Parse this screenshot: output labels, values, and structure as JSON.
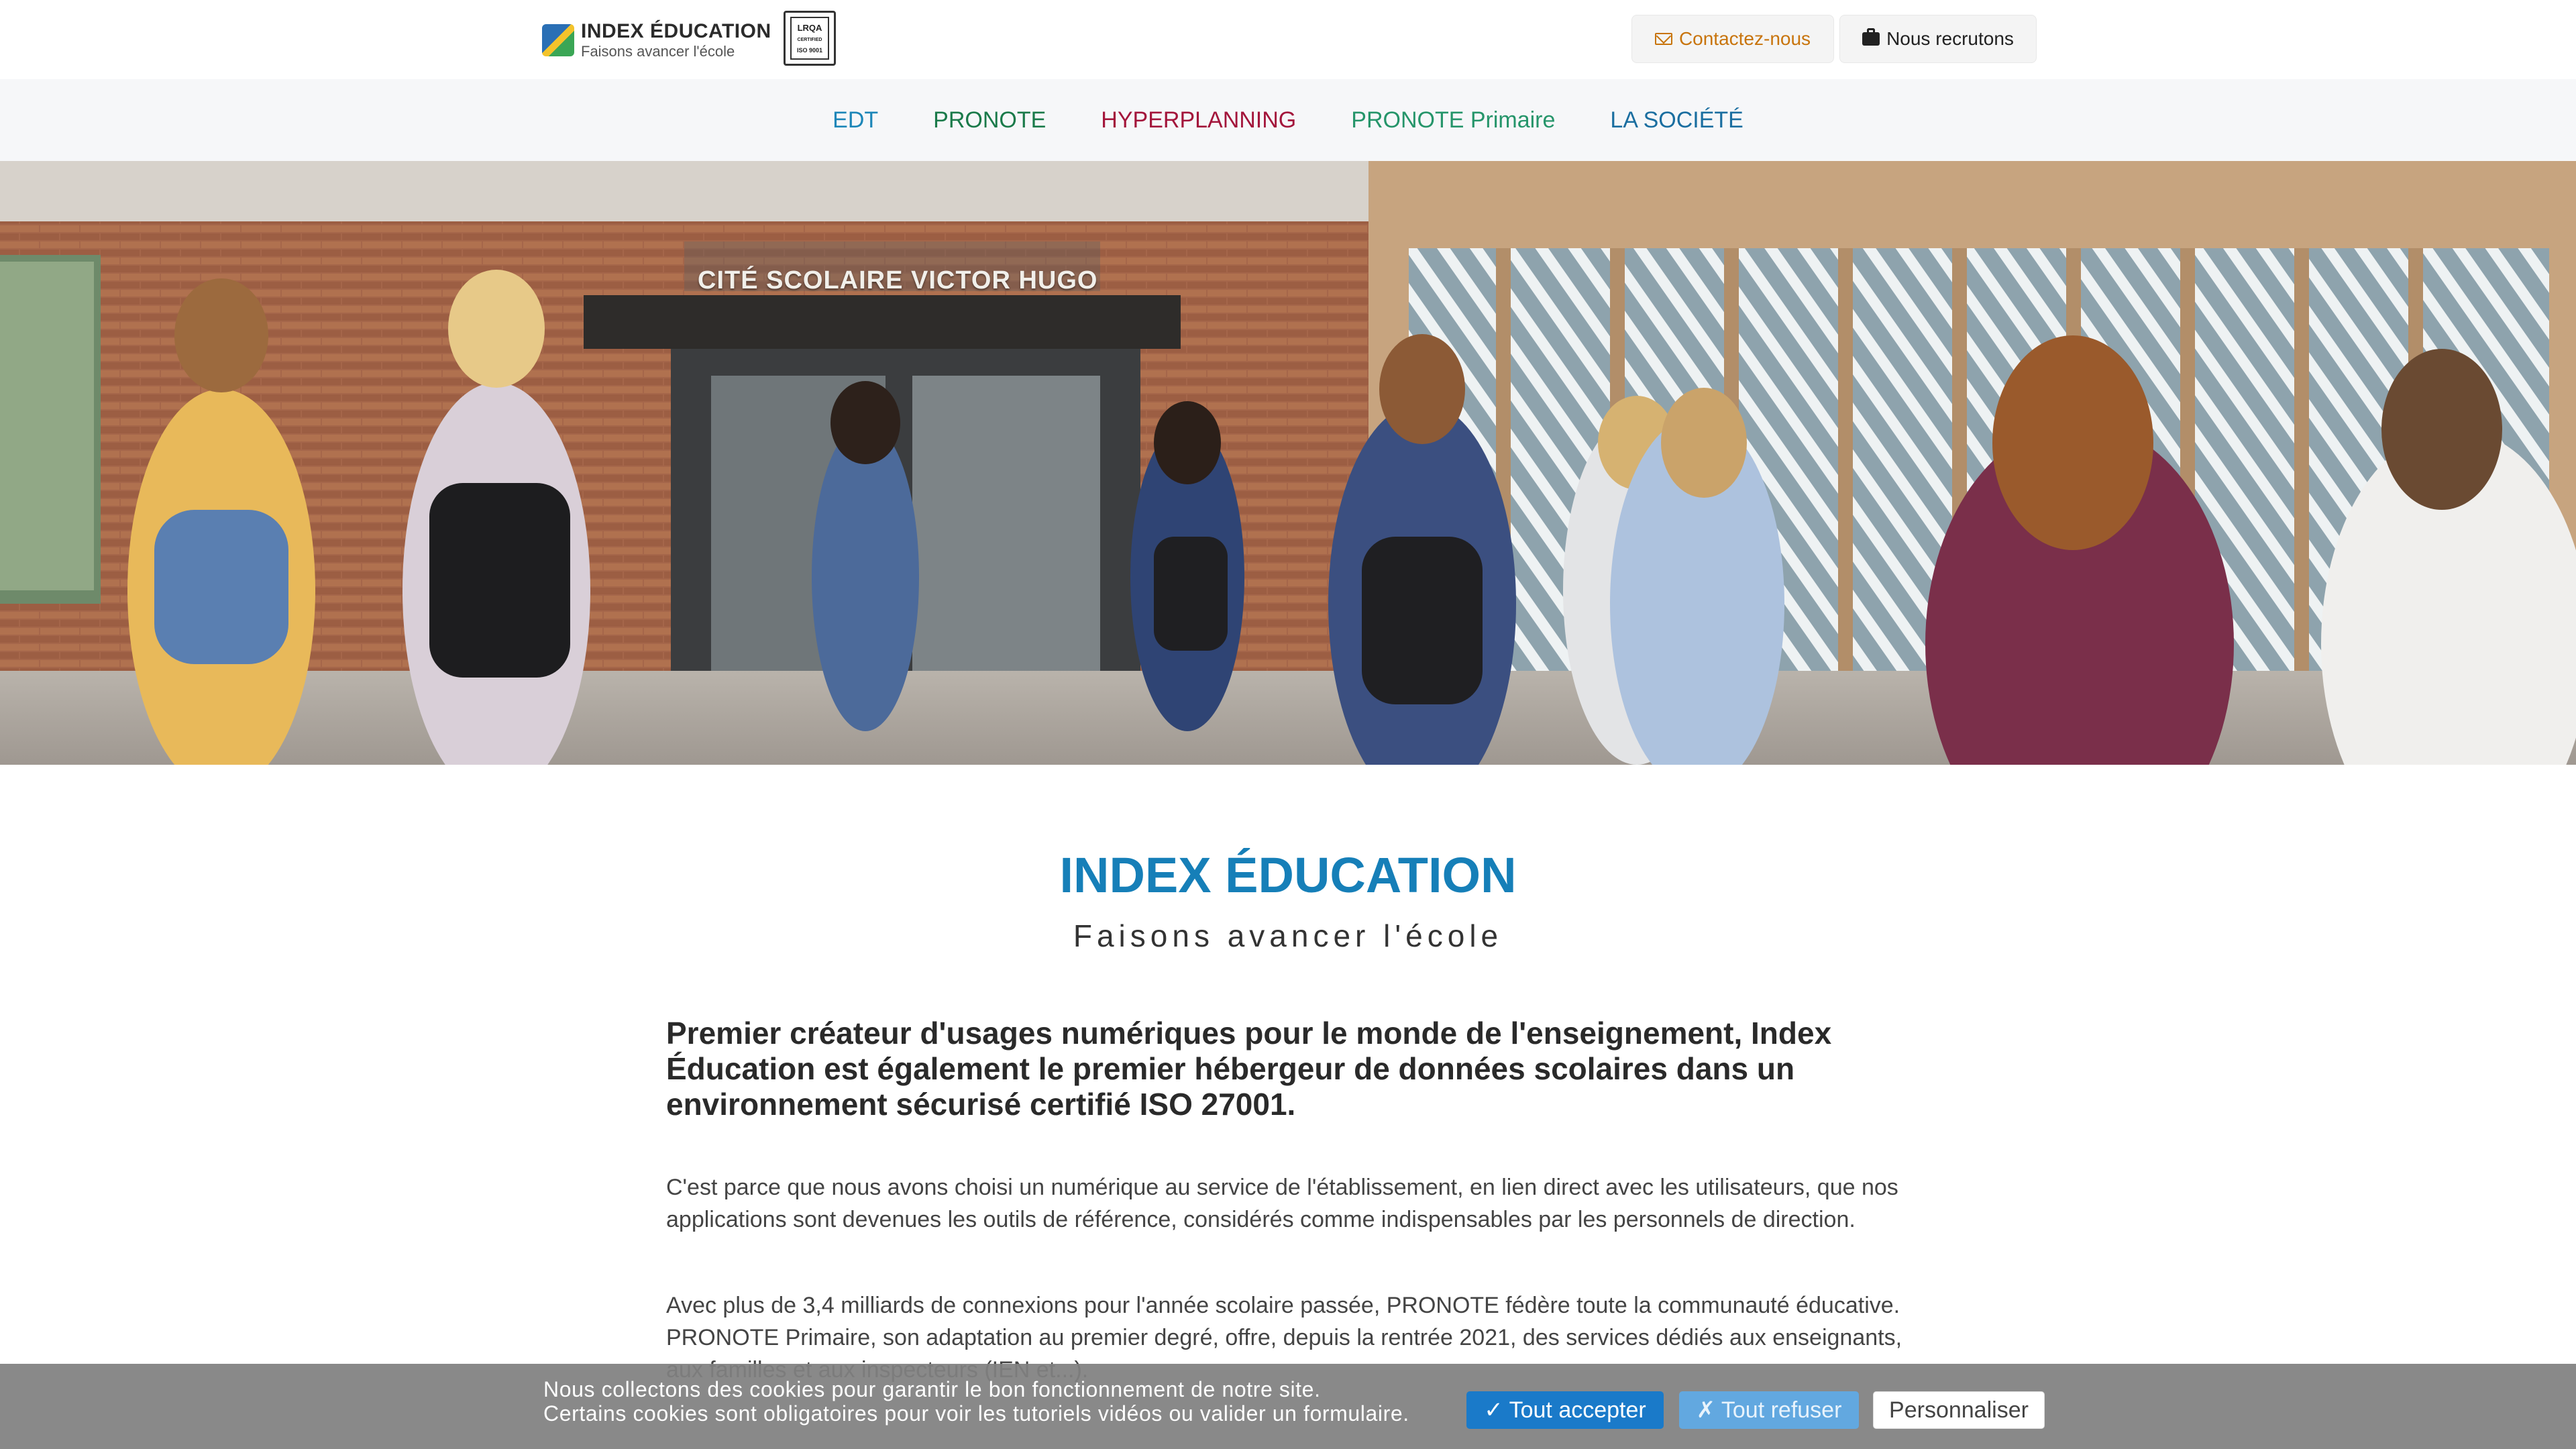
{
  "header": {
    "logo_name": "INDEX ÉDUCATION",
    "logo_tagline": "Faisons avancer l'école",
    "cert_top": "LRQA",
    "cert_mid": "CERTIFIED",
    "cert_bottom": "ISO 9001",
    "contact_label": "Contactez-nous",
    "jobs_label": "Nous recrutons",
    "contact_color": "#c8740c"
  },
  "nav": {
    "items": [
      {
        "label": "EDT",
        "color": "#1c86b8"
      },
      {
        "label": "PRONOTE",
        "color": "#1a7a4a"
      },
      {
        "label": "HYPERPLANNING",
        "color": "#a3153b"
      },
      {
        "label": "PRONOTE Primaire",
        "color": "#25956a"
      },
      {
        "label": "LA SOCIÉTÉ",
        "color": "#1a6ea0"
      }
    ]
  },
  "hero": {
    "sign": "CITÉ SCOLAIRE VICTOR HUGO"
  },
  "main": {
    "title": "INDEX ÉDUCATION",
    "subtitle": "Faisons avancer l'école",
    "lead": "Premier créateur d'usages numériques pour le monde de l'enseignement, Index Éducation est également le premier hébergeur de données scolaires dans un environnement sécurisé certifié ISO 27001.",
    "paragraph1": "C'est parce que nous avons choisi un numérique au service de l'établissement, en lien direct avec les utilisateurs, que nos applications sont devenues les outils de référence, considérés comme indispensables par les personnels de direction.",
    "paragraph2": "Avec plus de 3,4 milliards de connexions pour l'année scolaire passée, PRONOTE fédère toute la communauté éducative. PRONOTE Primaire, son adaptation au premier degré, offre, depuis la rentrée 2021, des services dédiés aux enseignants, aux familles et aux inspecteurs (IEN et...)."
  },
  "cookie": {
    "line1": "Nous collectons des cookies pour garantir le bon fonctionnement de notre site.",
    "line2": "Certains cookies sont obligatoires pour voir les tutoriels vidéos ou valider un formulaire.",
    "accept_label": "✓ Tout accepter",
    "refuse_label": "✗ Tout refuser",
    "custom_label": "Personnaliser"
  },
  "colors": {
    "brand_blue": "#167fb8",
    "accept_blue": "#1a7ac9",
    "refuse_blue": "#62a8e0"
  }
}
